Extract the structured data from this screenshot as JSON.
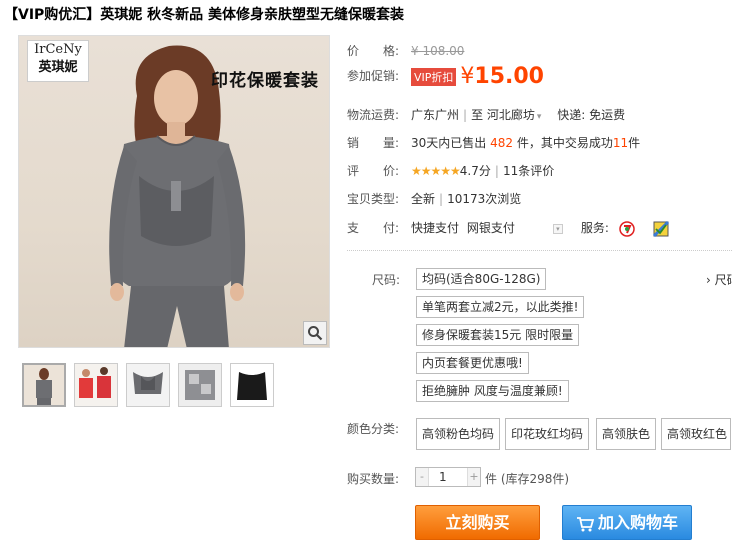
{
  "product": {
    "title": "【VIP购优汇】英琪妮 秋冬新品 美体修身亲肤塑型无缝保暖套装"
  },
  "image": {
    "logo_en": "IrCeNy",
    "logo_cn": "英琪妮",
    "promo_text": "印花保暖套装"
  },
  "price": {
    "label": "价　　格:",
    "original": "¥ 108.00",
    "promo_label": "参加促销:",
    "badge": "VIP折扣",
    "currency": "¥",
    "current": "15.00"
  },
  "logistics": {
    "label": "物流运费:",
    "from": "广东广州",
    "to": "至 河北廊坊",
    "to_arrow": "▾",
    "express": "快递: 免运费"
  },
  "sales": {
    "label": "销　　量:",
    "prefix": "30天内已售出",
    "count": "482",
    "mid": "件，其中交易成功",
    "success": "11",
    "suffix": "件"
  },
  "rating": {
    "label": "评　　价:",
    "stars": "★★★★★",
    "score": "4.7分",
    "reviews": "11条评价"
  },
  "type": {
    "label": "宝贝类型:",
    "condition": "全新",
    "views": "10173次浏览"
  },
  "payment": {
    "label": "支　　付:",
    "method1": "快捷支付",
    "method2": "网银支付",
    "service_label": "服务:"
  },
  "sku": {
    "size_label": "尺码:",
    "size_value": "均码(适合80G-128G)",
    "size_chart": "› 尺码",
    "notes": [
      "单笔两套立减2元，以此类推!",
      "修身保暖套装15元 限时限量",
      "内页套餐更优惠哦!",
      "拒绝臃肿 风度与温度兼顾!"
    ],
    "color_label": "颜色分类:",
    "colors": [
      "高领粉色均码",
      "印花玫红均码",
      "高领肤色",
      "高领玫红色"
    ]
  },
  "quantity": {
    "label": "购买数量:",
    "minus": "-",
    "value": "1",
    "plus": "+",
    "stock": "件 (库存298件)"
  },
  "actions": {
    "buy": "立刻购买",
    "cart": "加入购物车"
  },
  "colors": {
    "accent": "#ff4400",
    "buy_button": "#f06b00",
    "cart_button": "#2a8ae0",
    "badge": "#e64b3c"
  },
  "icons": [
    "zoom-icon",
    "tmall-service-icon",
    "secure-service-icon",
    "cart-icon"
  ]
}
